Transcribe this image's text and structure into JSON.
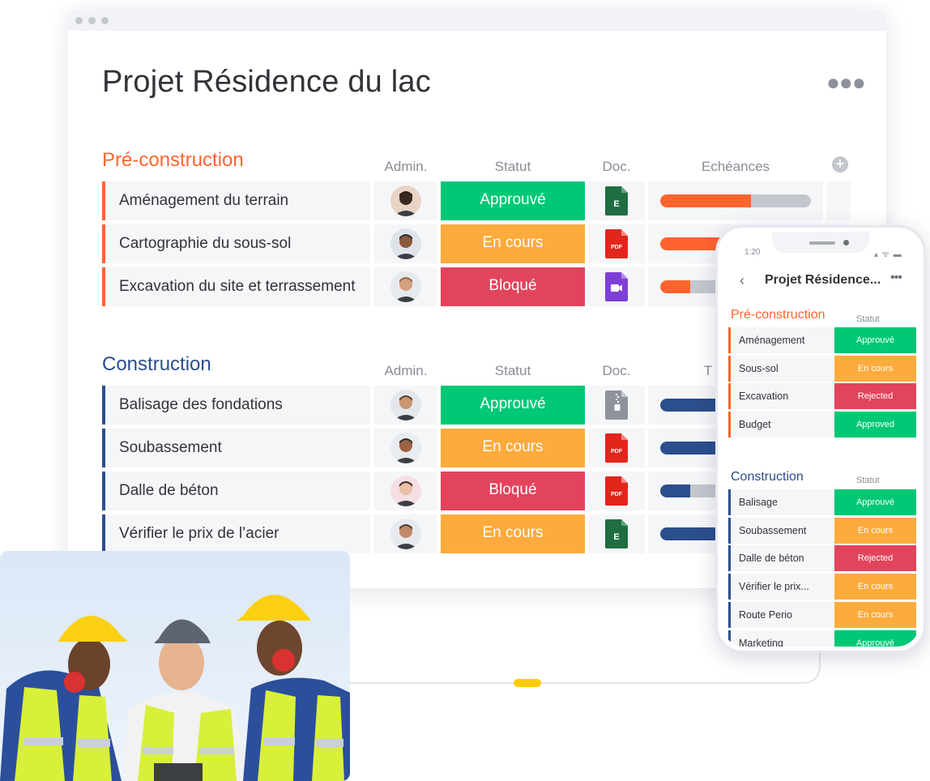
{
  "colors": {
    "orange_group": "#ff642e",
    "blue_group": "#2b4e8c",
    "approved": "#00c875",
    "in_progress": "#fdab3d",
    "blocked": "#e2445c",
    "progress_blue": "#2b4e8c",
    "progress_track": "#c4c6ce"
  },
  "board": {
    "title": "Projet Résidence du lac",
    "more_icon": "more-dots-icon",
    "columns": {
      "admin": "Admin.",
      "status": "Statut",
      "doc": "Doc.",
      "deadlines": "Echéances",
      "deadlines_cut": "T"
    },
    "add_column_icon": "plus-circle-icon",
    "groups": [
      {
        "title": "Pré-construction",
        "color": "#ff642e",
        "rows": [
          {
            "name": "Aménagement du terrain",
            "status": "Approuvé",
            "doc": "excel-icon",
            "progress": 0.6
          },
          {
            "name": "Cartographie du sous-sol",
            "status": "En cours",
            "doc": "pdf-icon",
            "progress": 0.45
          },
          {
            "name": "Excavation du site et terrassement",
            "status": "Bloqué",
            "doc": "video-icon",
            "progress": 0.2
          }
        ]
      },
      {
        "title": "Construction",
        "color": "#2b4e8c",
        "rows": [
          {
            "name": "Balisage des fondations",
            "status": "Approuvé",
            "doc": "zip-icon",
            "progress": 0.5
          },
          {
            "name": "Soubassement",
            "status": "En cours",
            "doc": "pdf-icon",
            "progress": 0.55
          },
          {
            "name": "Dalle de béton",
            "status": "Bloqué",
            "doc": "pdf-icon",
            "progress": 0.2
          },
          {
            "name": "Vérifier le prix de l’acier",
            "status": "En cours",
            "doc": "excel-icon",
            "progress": 0.5
          }
        ]
      }
    ]
  },
  "doc_labels": {
    "excel": "E",
    "pdf": "PDF"
  },
  "phone": {
    "time": "1:20",
    "status_icons": "▴ ᯤ ▬",
    "back_icon": "chevron-left-icon",
    "title": "Projet Résidence...",
    "more_icon": "more-dots-icon",
    "status_header": "Statut",
    "groups": [
      {
        "title": "Pré-construction",
        "rows": [
          {
            "name": "Aménagement",
            "status": "Approuvé"
          },
          {
            "name": "Sous-sol",
            "status": "En cours"
          },
          {
            "name": "Excavation",
            "status": "Rejected"
          },
          {
            "name": "Budget",
            "status": "Approved"
          }
        ]
      },
      {
        "title": "Construction",
        "rows": [
          {
            "name": "Balisage",
            "status": "Approuvé"
          },
          {
            "name": "Soubassement",
            "status": "En cours"
          },
          {
            "name": "Dalle de béton",
            "status": "Rejected"
          },
          {
            "name": "Vérifier le prix...",
            "status": "En cours"
          },
          {
            "name": "Route Perio",
            "status": "En cours"
          },
          {
            "name": "Marketing",
            "status": "Approuvé"
          }
        ]
      }
    ]
  },
  "photo": {
    "subject": "three-construction-workers-photo"
  }
}
